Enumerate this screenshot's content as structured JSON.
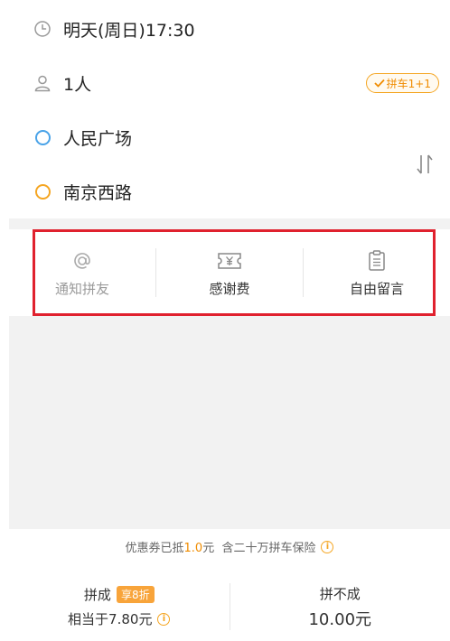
{
  "trip": {
    "time": "明天(周日)17:30",
    "passengers": "1人",
    "carpool_tag": "拼车1+1",
    "origin": "人民广场",
    "destination": "南京西路"
  },
  "actions": [
    {
      "label": "通知拼友",
      "icon": "at-icon"
    },
    {
      "label": "感谢费",
      "icon": "yen-ticket-icon"
    },
    {
      "label": "自由留言",
      "icon": "clipboard-icon"
    }
  ],
  "coupon": {
    "prefix": "优惠券已抵",
    "amount": "1.0",
    "suffix": "元  含二十万拼车保险"
  },
  "price": {
    "success_title": "拼成",
    "success_badge": "享8折",
    "success_sub": "相当于7.80元",
    "fail_title": "拼不成",
    "fail_price": "10.00元"
  },
  "colors": {
    "accent": "#f5a623",
    "origin_dot": "#4aa3e8",
    "highlight": "#e0212e"
  }
}
